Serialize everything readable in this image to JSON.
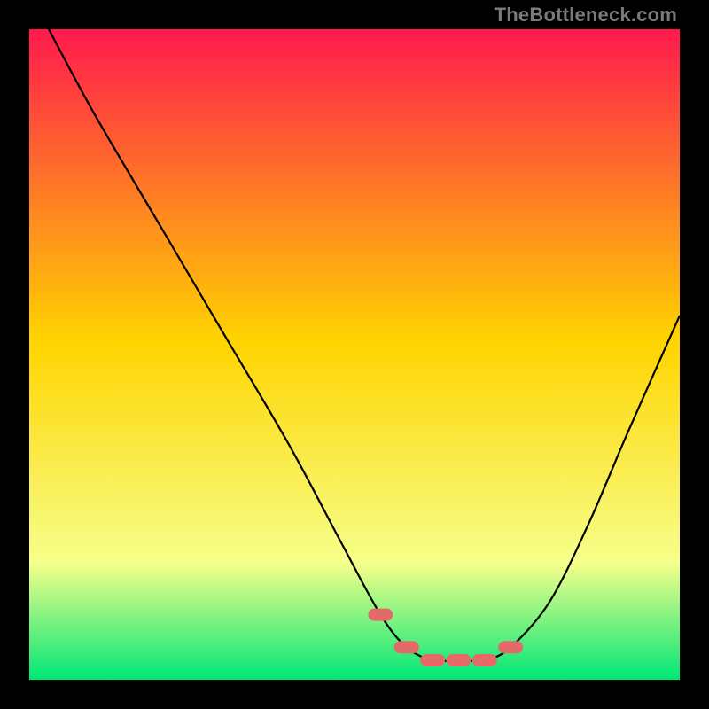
{
  "attribution": "TheBottleneck.com",
  "colors": {
    "bg": "#000000",
    "gradient_top": "#ff1a4d",
    "gradient_mid": "#ffd400",
    "gradient_low": "#f6ff8a",
    "gradient_bottom": "#00e676",
    "curve": "#000000",
    "marker": "#e46a6a"
  },
  "chart_data": {
    "type": "line",
    "title": "",
    "xlabel": "",
    "ylabel": "",
    "xlim": [
      0,
      100
    ],
    "ylim": [
      0,
      100
    ],
    "series": [
      {
        "name": "bottleneck-curve",
        "x": [
          3,
          10,
          20,
          30,
          40,
          48,
          54,
          58,
          62,
          66,
          70,
          74,
          80,
          86,
          92,
          100
        ],
        "y": [
          100,
          87,
          70,
          53,
          36,
          21,
          10,
          5,
          3,
          3,
          3,
          5,
          12,
          24,
          38,
          56
        ]
      }
    ],
    "markers": {
      "name": "optimal-range",
      "x": [
        54,
        58,
        62,
        66,
        70,
        74
      ],
      "y": [
        10,
        5,
        3,
        3,
        3,
        5
      ]
    }
  }
}
